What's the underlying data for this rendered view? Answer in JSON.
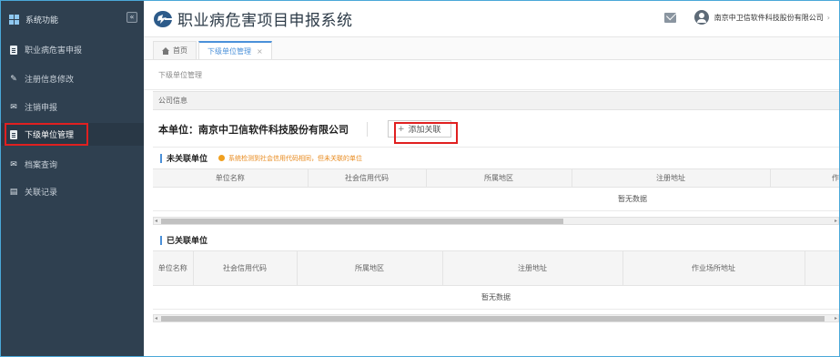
{
  "sidebar": {
    "header": "系统功能",
    "collapse": "«",
    "items": [
      {
        "label": "职业病危害申报"
      },
      {
        "label": "注册信息修改"
      },
      {
        "label": "注销申报"
      },
      {
        "label": "下级单位管理"
      },
      {
        "label": "档案查询"
      },
      {
        "label": "关联记录"
      }
    ]
  },
  "header": {
    "title": "职业病危害项目申报系统",
    "company": "南京中卫信软件科技股份有限公司",
    "arrow": "›"
  },
  "tabs": [
    {
      "label": "首页"
    },
    {
      "label": "下级单位管理",
      "close": "×"
    }
  ],
  "breadcrumb": "下级单位管理",
  "section": {
    "title": "公司信息"
  },
  "unit": {
    "label": "本单位：南京中卫信软件科技股份有限公司",
    "add_button": "添加关联"
  },
  "unlinked": {
    "title": "未关联单位",
    "warning": "系统检测到社会信用代码相同，但未关联的单位",
    "columns": [
      "单位名称",
      "社会信用代码",
      "所属地区",
      "注册地址",
      "作"
    ],
    "empty": "暂无数据",
    "scroll_fraction": 0.6
  },
  "linked": {
    "title": "已关联单位",
    "columns": [
      "单位名称",
      "社会信用代码",
      "所属地区",
      "注册地址",
      "作业场所地址"
    ],
    "empty": "暂无数据",
    "scroll_fraction": 0.99
  },
  "colors": {
    "sidebar_bg": "#2f4050",
    "accent": "#4a90d9",
    "highlight": "#e02020",
    "warning": "#e8891b"
  }
}
